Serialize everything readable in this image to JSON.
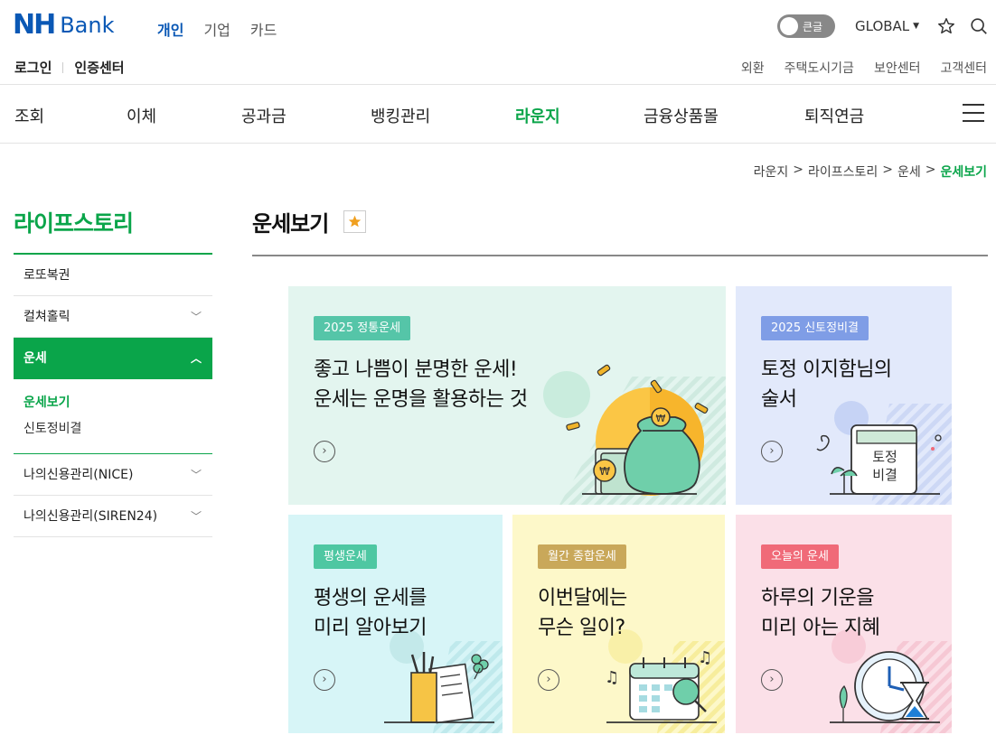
{
  "header": {
    "logo_nh": "NH",
    "logo_bank": "Bank",
    "segments": [
      "개인",
      "기업",
      "카드"
    ],
    "bigtext_label": "큰글",
    "global_label": "GLOBAL",
    "login_links": [
      "로그인",
      "인증센터"
    ],
    "util_links": [
      "외환",
      "주택도시기금",
      "보안센터",
      "고객센터"
    ]
  },
  "gnb": {
    "items": [
      "조회",
      "이체",
      "공과금",
      "뱅킹관리",
      "라운지",
      "금융상품몰",
      "퇴직연금"
    ],
    "active": "라운지"
  },
  "breadcrumb": [
    "라운지",
    ">",
    "라이프스토리",
    ">",
    "운세",
    ">",
    "운세보기"
  ],
  "lnb": {
    "title": "라이프스토리",
    "items": [
      "로또복권",
      "컬쳐홀릭",
      "운세",
      "나의신용관리(NICE)",
      "나의신용관리(SIREN24)"
    ],
    "sub_items": [
      "운세보기",
      "신토정비결"
    ]
  },
  "page": {
    "title": "운세보기"
  },
  "cards": [
    {
      "badge": "2025 정통운세",
      "line1": "좋고 나쁨이 분명한 운세!",
      "line2": "운세는 운명을 활용하는 것",
      "go": "›"
    },
    {
      "badge": "2025 신토정비결",
      "line1": "토정 이지함님의",
      "line2": "술서",
      "book_text1": "토정",
      "book_text2": "비결",
      "go": "›"
    },
    {
      "badge": "평생운세",
      "line1": "평생의 운세를",
      "line2": "미리 알아보기",
      "go": "›"
    },
    {
      "badge": "월간 종합운세",
      "line1": "이번달에는",
      "line2": "무슨 일이?",
      "go": "›"
    },
    {
      "badge": "오늘의 운세",
      "line1": "하루의 기운을",
      "line2": "미리 아는 지혜",
      "go": "›"
    }
  ],
  "colors": {
    "brand_blue": "#0a58b5",
    "accent_green": "#0aa54a",
    "badge_green": "#55c5a8",
    "badge_blue": "#7f9de6",
    "badge_teal": "#4ec7a2",
    "badge_gold": "#c9a85a",
    "badge_pink": "#f06a78"
  }
}
